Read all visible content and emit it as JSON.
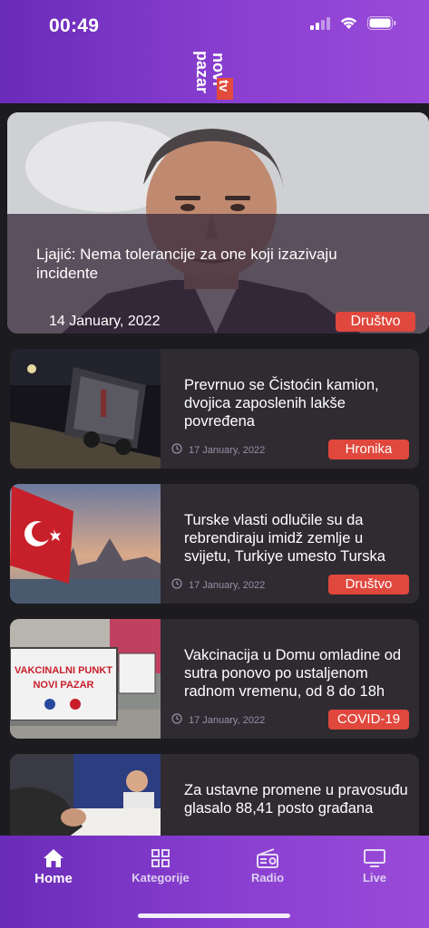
{
  "status_bar": {
    "time": "00:49"
  },
  "logo": {
    "line1": "novi",
    "line2": "pazar",
    "tv": "tv"
  },
  "hero": {
    "title": "Ljajić: Nema tolerancije za one koji izazivaju incidente",
    "date": "14 January, 2022",
    "category": "Društvo"
  },
  "articles": [
    {
      "title": "Prevrnuo se Čistoćin kamion, dvojica zaposlenih lakše povređena",
      "date": "17 January, 2022",
      "category": "Hronika"
    },
    {
      "title": "Turske vlasti odlučile su da rebrendiraju imidž zemlje u svijetu, Turkiye umesto Turska",
      "date": "17 January, 2022",
      "category": "Društvo"
    },
    {
      "title": "Vakcinacija u Domu omladine od sutra ponovo po ustaljenom radnom vremenu, od 8 do 18h",
      "date": "17 January, 2022",
      "category": "COVID-19",
      "image_text_line1": "VAKCINALNI PUNKT",
      "image_text_line2": "NOVI PAZAR"
    },
    {
      "title": "Za ustavne promene u pravosuđu glasalo 88,41 posto građana",
      "date": "",
      "category": ""
    }
  ],
  "tabs": [
    {
      "label": "Home",
      "icon": "home-icon",
      "active": true
    },
    {
      "label": "Kategorije",
      "icon": "grid-icon",
      "active": false
    },
    {
      "label": "Radio",
      "icon": "radio-icon",
      "active": false
    },
    {
      "label": "Live",
      "icon": "tv-icon",
      "active": false
    }
  ],
  "colors": {
    "header_gradient_start": "#6a2bb8",
    "header_gradient_end": "#9a4ad8",
    "badge": "#e0473d",
    "card_bg": "#2f2b31",
    "page_bg": "#1c1b1f"
  }
}
